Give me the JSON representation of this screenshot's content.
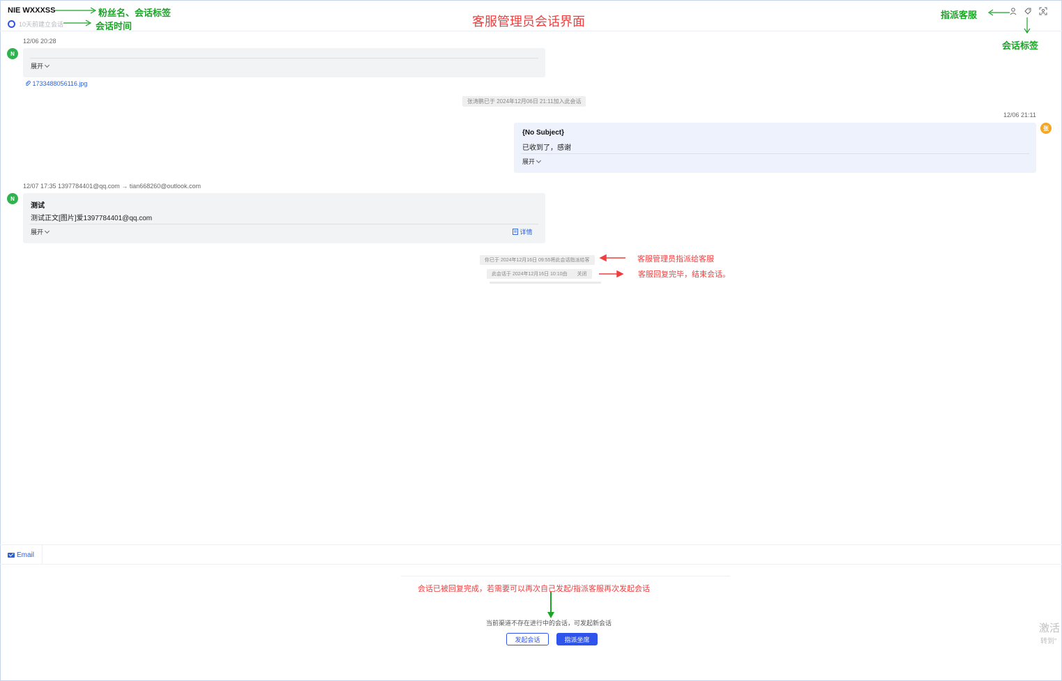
{
  "header": {
    "fan_name": "NIE WXXXSS",
    "session_time": "10天前建立会话",
    "page_heading": "客服管理员会话界面"
  },
  "annotations": {
    "fan_label": "粉丝名、会话标签",
    "time_label": "会话时间",
    "assign_label": "指派客服",
    "tag_label": "会话标签",
    "assign_note": "客服管理员指派给客服",
    "close_note": "客服回复完毕，结束会话。",
    "bottom_note": "会话已被回复完成，若需要可以再次自己发起/指派客服再次发起会话"
  },
  "messages": {
    "m1": {
      "timestamp": "12/06 20:28",
      "avatar": "N",
      "expand_label": "展开",
      "attachment": "1733488056116.jpg"
    },
    "join_notice": "张涛鹏已于 2024年12月06日 21:11加入此会话",
    "m2": {
      "timestamp": "12/06 21:11",
      "avatar": "张",
      "subject": "{No Subject}",
      "body": "已收到了，感谢",
      "expand_label": "展开"
    },
    "m3": {
      "meta": "12/07 17:35  1397784401@qq.com → tian668260@outlook.com",
      "avatar": "N",
      "subject": "测试",
      "body": "测试正文[图片]爱1397784401@qq.com",
      "expand_label": "展开",
      "detail_label": "详情"
    },
    "assign_notice": "你已于 2024年12月16日 09:55将此会话指派给客",
    "close_notice_a": "此会话于 2024年12月16日 10:10由",
    "close_notice_b": "关闭"
  },
  "channel": {
    "tab_label": "Email"
  },
  "footer": {
    "notice": "当前渠道不存在进行中的会话，可发起新会话",
    "start_button": "发起会话",
    "assign_button": "指派坐席"
  },
  "watermark": {
    "line1": "激活",
    "line2": "转到\""
  },
  "colors": {
    "primary": "#2f54eb",
    "annotation_green": "#1aa526",
    "annotation_red": "#f03e3e",
    "avatar_green": "#2fb34e",
    "avatar_orange": "#f5a623"
  },
  "icons": [
    "user-icon",
    "tag-icon",
    "scan-user-icon",
    "paperclip-icon",
    "document-icon",
    "mail-icon",
    "chevron-down-icon"
  ]
}
